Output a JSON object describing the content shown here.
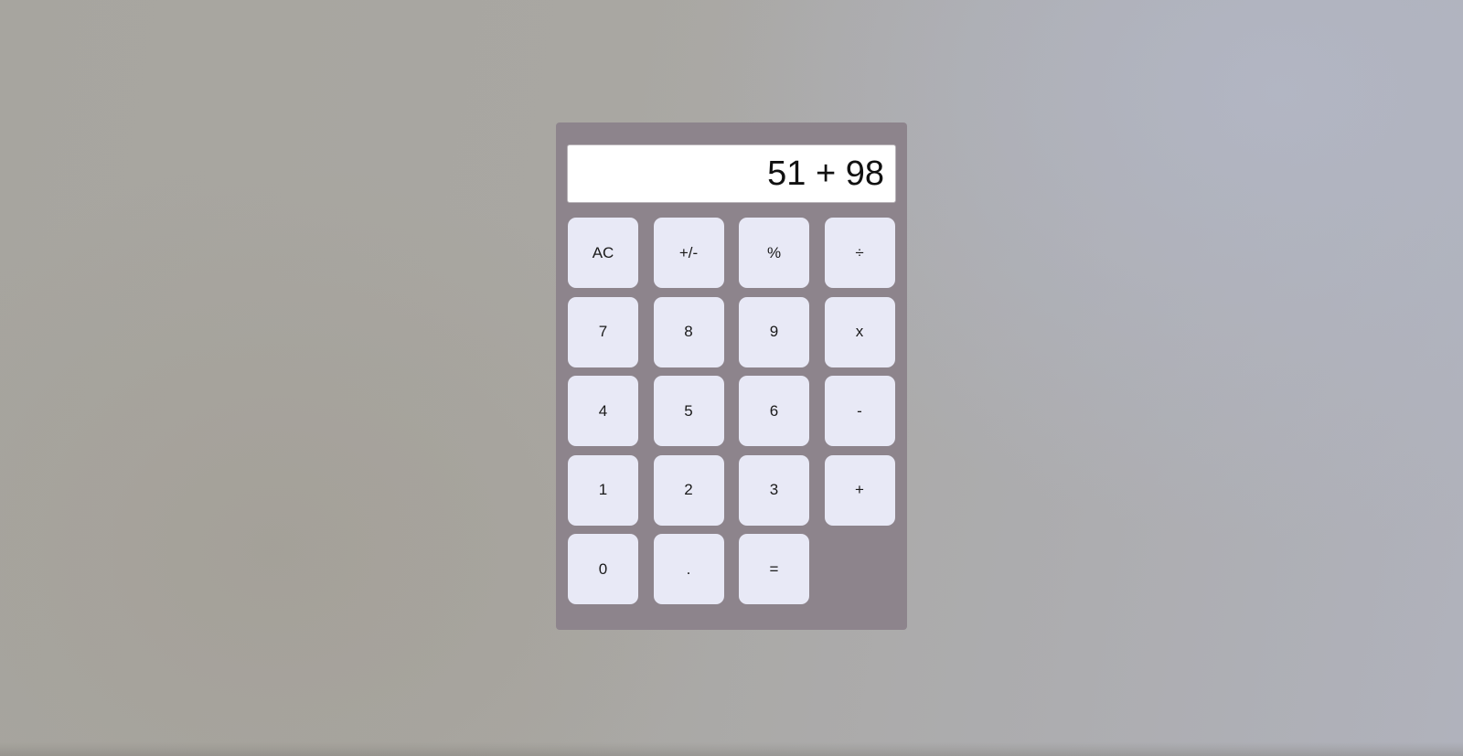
{
  "display": {
    "value": "51 + 98"
  },
  "keys": {
    "ac": "AC",
    "sign": "+/-",
    "percent": "%",
    "divide": "÷",
    "seven": "7",
    "eight": "8",
    "nine": "9",
    "multiply": "x",
    "four": "4",
    "five": "5",
    "six": "6",
    "minus": "-",
    "one": "1",
    "two": "2",
    "three": "3",
    "plus": "+",
    "zero": "0",
    "decimal": ".",
    "equals": "="
  },
  "colors": {
    "calculator_body": "#8d848c",
    "key_background": "#e8e9f6",
    "display_background": "#ffffff"
  }
}
